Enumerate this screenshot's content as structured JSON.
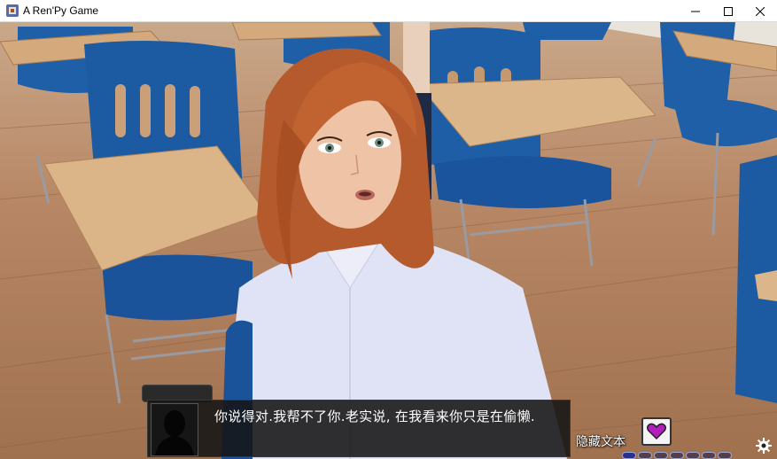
{
  "window": {
    "title": "A Ren'Py Game",
    "icon": "renpy-app-icon",
    "controls": [
      "minimize-icon",
      "maximize-icon",
      "close-icon"
    ]
  },
  "dialogue": {
    "speaker": "",
    "text": "你说得对.我帮不了你.老实说, 在我看来你只是在偷懒."
  },
  "quick_menu": {
    "hide_text_label": "隐藏文本",
    "heart_icon": "heart-icon",
    "gear_icon": "gear-icon",
    "progress_slots_total": 7,
    "progress_slots_filled": 1
  },
  "colors": {
    "accent_purple": "#b21fbf",
    "slot_blue": "#2b2f8f"
  }
}
